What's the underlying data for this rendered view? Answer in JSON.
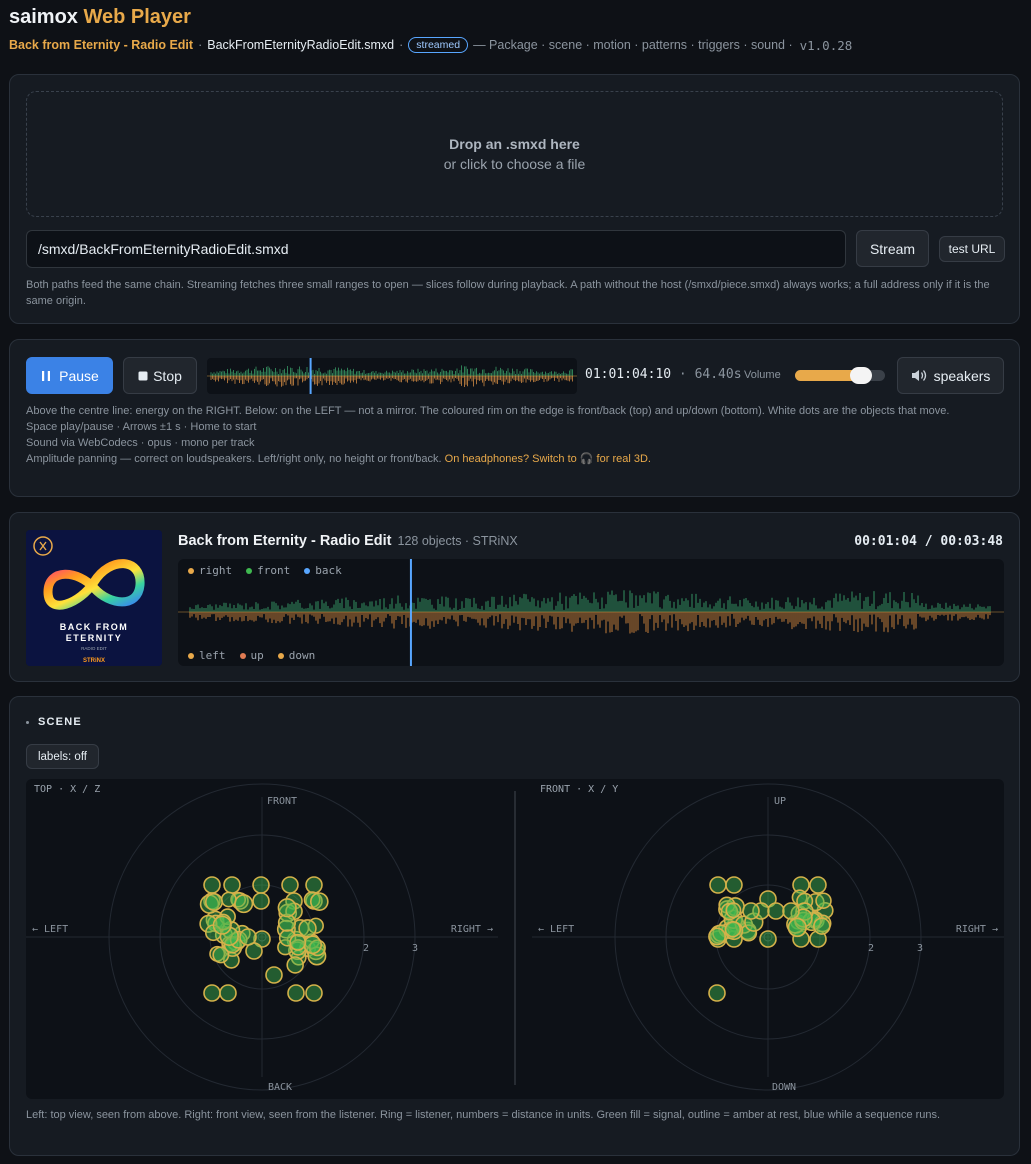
{
  "app": {
    "title_prefix": "saimox",
    "title_accent": "Web Player"
  },
  "subline": {
    "track": "Back from Eternity - Radio Edit",
    "dot": "·",
    "file": "BackFromEternityRadioEdit.smxd",
    "badge": "streamed",
    "dash": "—",
    "features": "Package · scene · motion · patterns · triggers · sound ·",
    "version": "v1.0.28"
  },
  "loader": {
    "drop_title": "Drop an .smxd here",
    "drop_sub": "or click to choose a file",
    "path_value": "/smxd/BackFromEternityRadioEdit.smxd",
    "stream_label": "Stream",
    "test_label": "test URL",
    "note": "Both paths feed the same chain. Streaming fetches three small ranges to open — slices follow during playback. A path without the host (/smxd/piece.smxd) always works; a full address only if it is the same origin."
  },
  "transport": {
    "pause_label": "Pause",
    "stop_label": "Stop",
    "timecode": "01:01:04:10",
    "sep": "·",
    "seconds": "64.40s",
    "volume_label": "Volume",
    "volume_level": 0.73,
    "speakers_label": "speakers",
    "playhead_fraction": 0.28,
    "notes": [
      "Above the centre line: energy on the RIGHT. Below: on the LEFT — not a mirror. The coloured rim on the edge is front/back (top) and up/down (bottom). White dots are the objects that move.",
      "Space play/pause · Arrows ±1 s · Home to start",
      "Sound via WebCodecs · opus · mono per track"
    ],
    "pan_note": "Amplitude panning — correct on loudspeakers. Left/right only, no height or front/back.",
    "pan_warn": "On headphones? Switch to 🎧 for real 3D."
  },
  "track": {
    "title": "Back from Eternity - Radio Edit",
    "meta": "128 objects · STRiNX",
    "time": "00:01:04 / 00:03:48",
    "playhead_fraction": 0.282,
    "cover": {
      "line1": "BACK FROM",
      "line2": "ETERNITY",
      "sub": "RADIO EDIT",
      "brand": "STRiNX"
    },
    "legend_top": [
      {
        "label": "right",
        "color": "#e8a94a"
      },
      {
        "label": "front",
        "color": "#3fb950"
      },
      {
        "label": "back",
        "color": "#58a6ff"
      }
    ],
    "legend_bottom": [
      {
        "label": "left",
        "color": "#e8a94a"
      },
      {
        "label": "up",
        "color": "#e07b53"
      },
      {
        "label": "down",
        "color": "#e8a94a"
      }
    ]
  },
  "scene": {
    "title": "SCENE",
    "labels_button": "labels: off",
    "top_view": {
      "title": "TOP · X / Z",
      "up": "FRONT",
      "down": "BACK",
      "left": "← LEFT",
      "right": "RIGHT →",
      "ticks": [
        "2",
        "3"
      ]
    },
    "front_view": {
      "title": "FRONT · X / Y",
      "up": "UP",
      "down": "DOWN",
      "left": "← LEFT",
      "right": "RIGHT →",
      "ticks": [
        "2",
        "3"
      ]
    },
    "note": "Left: top view, seen from above. Right: front view, seen from the listener. Ring = listener, numbers = distance in units. Green fill = signal, outline = amber at rest, blue while a sequence runs.",
    "colors": {
      "signal": "#3fb950",
      "rest": "#d4b14a",
      "running": "#58a6ff"
    }
  }
}
